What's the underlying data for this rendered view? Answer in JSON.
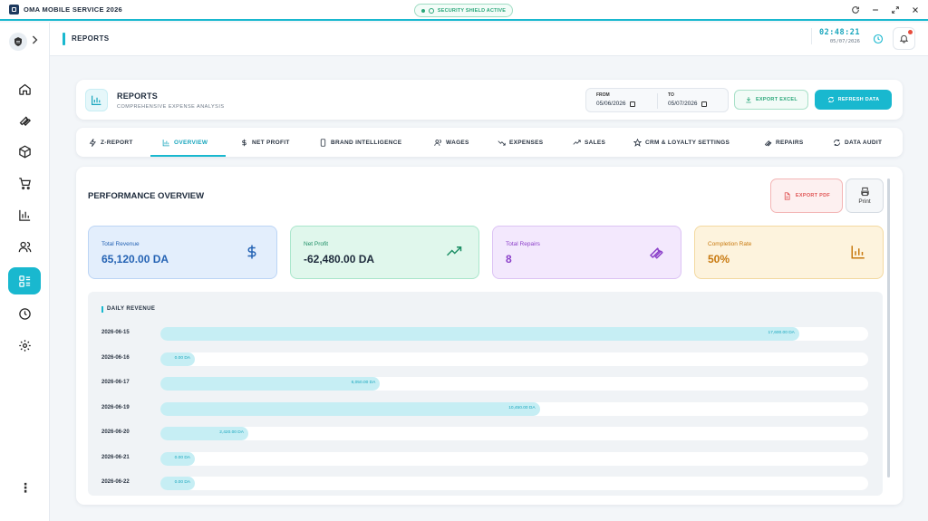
{
  "app": {
    "title": "OMA MOBILE SERVICE 2026"
  },
  "security": {
    "label": "SECURITY SHIELD ACTIVE"
  },
  "header": {
    "title": "REPORTS",
    "time": "02:48:21",
    "date": "05/07/2026"
  },
  "reports": {
    "title": "REPORTS",
    "subtitle": "COMPREHENSIVE EXPENSE ANALYSIS",
    "from_label": "FROM",
    "from_value": "05/06/2026",
    "to_label": "TO",
    "to_value": "05/07/2026",
    "export_excel": "EXPORT EXCEL",
    "refresh": "REFRESH DATA"
  },
  "tabs": [
    {
      "label": "Z-REPORT",
      "icon": "bolt-icon"
    },
    {
      "label": "OVERVIEW",
      "icon": "bar-chart-icon"
    },
    {
      "label": "NET PROFIT",
      "icon": "dollar-icon"
    },
    {
      "label": "BRAND INTELLIGENCE",
      "icon": "phone-icon"
    },
    {
      "label": "WAGES",
      "icon": "users-icon"
    },
    {
      "label": "EXPENSES",
      "icon": "trend-down-icon"
    },
    {
      "label": "SALES",
      "icon": "trend-up-icon"
    },
    {
      "label": "CRM & LOYALTY SETTINGS",
      "icon": "star-icon"
    },
    {
      "label": "REPAIRS",
      "icon": "wrench-icon"
    },
    {
      "label": "DATA AUDIT",
      "icon": "refresh-icon"
    }
  ],
  "overview": {
    "title": "PERFORMANCE OVERVIEW",
    "export_pdf": "EXPORT PDF",
    "print": "Print",
    "stats": [
      {
        "label": "Total Revenue",
        "value": "65,120.00 DA",
        "color": "#2563b4",
        "bg": "#e3eefc",
        "border": "#bcd5f5",
        "icon": "dollar-icon"
      },
      {
        "label": "Net Profit",
        "value": "-62,480.00 DA",
        "color": "#1e8f66",
        "bg": "#e0f7ec",
        "border": "#a9e6cb",
        "icon": "trend-up-icon"
      },
      {
        "label": "Total Repairs",
        "value": "8",
        "color": "#8b3fc9",
        "bg": "#f3e8fd",
        "border": "#dcc3f4",
        "icon": "wrench-icon"
      },
      {
        "label": "Completion Rate",
        "value": "50%",
        "color": "#c8790f",
        "bg": "#fdf3dd",
        "border": "#f3d9a0",
        "icon": "bar-chart-icon"
      }
    ]
  },
  "daily_revenue": {
    "title": "DAILY REVENUE",
    "rows": [
      {
        "date": "2026-06-15",
        "amount": "17,600.00 DA",
        "value": 17600
      },
      {
        "date": "2026-06-16",
        "amount": "0.00 DA",
        "value": 0
      },
      {
        "date": "2026-06-17",
        "amount": "6,050.00 DA",
        "value": 6050
      },
      {
        "date": "2026-06-19",
        "amount": "10,450.00 DA",
        "value": 10450
      },
      {
        "date": "2026-06-20",
        "amount": "2,420.00 DA",
        "value": 2420
      },
      {
        "date": "2026-06-21",
        "amount": "0.00 DA",
        "value": 0
      },
      {
        "date": "2026-06-22",
        "amount": "0.00 DA",
        "value": 0
      }
    ],
    "max": 19500
  },
  "colors": {
    "accent": "#19b8cf",
    "danger": "#e05454",
    "success": "#2aa77a"
  }
}
